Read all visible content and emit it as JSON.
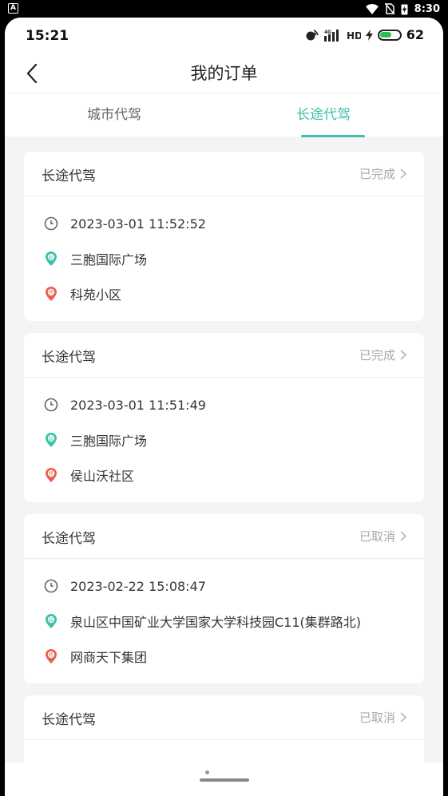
{
  "system_bar": {
    "time": "8:30"
  },
  "status": {
    "time": "15:21",
    "battery": "62"
  },
  "nav": {
    "title": "我的订单"
  },
  "tabs": [
    {
      "label": "城市代驾",
      "active": false
    },
    {
      "label": "长途代驾",
      "active": true
    }
  ],
  "orders": [
    {
      "type": "长途代驾",
      "status": "已完成",
      "time": "2023-03-01 11:52:52",
      "start": "三胞国际广场",
      "end": "科苑小区"
    },
    {
      "type": "长途代驾",
      "status": "已完成",
      "time": "2023-03-01 11:51:49",
      "start": "三胞国际广场",
      "end": "侯山沃社区"
    },
    {
      "type": "长途代驾",
      "status": "已取消",
      "time": "2023-02-22 15:08:47",
      "start": "泉山区中国矿业大学国家大学科技园C11(集群路北)",
      "end": "网商天下集团"
    },
    {
      "type": "长途代驾",
      "status": "已取消"
    }
  ],
  "icons": {
    "start_marker": "起",
    "end_marker": "终"
  },
  "colors": {
    "accent": "#3cc0a8",
    "start": "#3cc0a8",
    "end": "#e9604f"
  }
}
